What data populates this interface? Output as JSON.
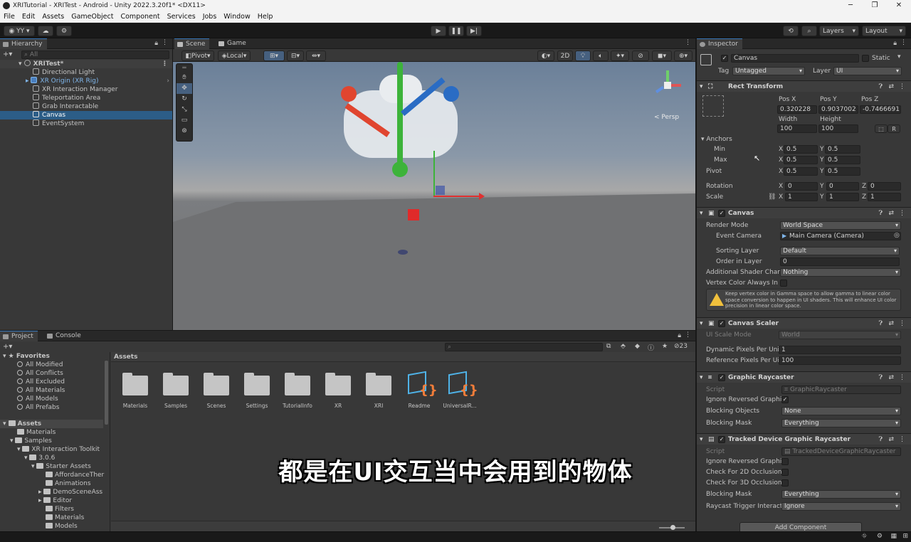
{
  "window": {
    "title": "XRITutorial - XRITest - Android - Unity 2022.3.20f1* <DX11>"
  },
  "menu": [
    "File",
    "Edit",
    "Assets",
    "GameObject",
    "Component",
    "Services",
    "Jobs",
    "Window",
    "Help"
  ],
  "toolbar": {
    "account": "YY",
    "layers": "Layers",
    "layout": "Layout"
  },
  "hierarchy": {
    "tab": "Hierarchy",
    "search_placeholder": "All",
    "scene": "XRITest*",
    "items": [
      "Directional Light",
      "XR Origin (XR Rig)",
      "XR Interaction Manager",
      "Teleportation Area",
      "Grab Interactable",
      "Canvas",
      "EventSystem"
    ],
    "selected": "Canvas"
  },
  "scene": {
    "tabs": [
      "Scene",
      "Game"
    ],
    "pivot": "Pivot",
    "local": "Local",
    "mode_2d": "2D",
    "persp": "< Persp"
  },
  "inspector": {
    "tab": "Inspector",
    "object_name": "Canvas",
    "static_label": "Static",
    "tag_label": "Tag",
    "tag_value": "Untagged",
    "layer_label": "Layer",
    "layer_value": "UI",
    "rect_transform": {
      "title": "Rect Transform",
      "pos_x_label": "Pos X",
      "pos_y_label": "Pos Y",
      "pos_z_label": "Pos Z",
      "pos_x": "0.320228",
      "pos_y": "0.9037002",
      "pos_z": "-0.7466691",
      "width_label": "Width",
      "height_label": "Height",
      "width": "100",
      "height": "100",
      "r_button": "R",
      "anchors_label": "Anchors",
      "min_label": "Min",
      "max_label": "Max",
      "min_x": "0.5",
      "min_y": "0.5",
      "max_x": "0.5",
      "max_y": "0.5",
      "pivot_label": "Pivot",
      "pivot_x": "0.5",
      "pivot_y": "0.5",
      "rotation_label": "Rotation",
      "rot_x": "0",
      "rot_y": "0",
      "rot_z": "0",
      "scale_label": "Scale",
      "scale_x": "1",
      "scale_y": "1",
      "scale_z": "1",
      "axis_x": "X",
      "axis_y": "Y",
      "axis_z": "Z"
    },
    "canvas": {
      "title": "Canvas",
      "render_mode_label": "Render Mode",
      "render_mode": "World Space",
      "event_camera_label": "Event Camera",
      "event_camera": "Main Camera (Camera)",
      "sorting_layer_label": "Sorting Layer",
      "sorting_layer": "Default",
      "order_label": "Order in Layer",
      "order": "0",
      "shader_label": "Additional Shader Char",
      "shader": "Nothing",
      "vertex_label": "Vertex Color Always In",
      "warning": "Keep vertex color in Gamma space to allow gamma to linear color space conversion to happen in UI shaders. This will enhance UI color precision in linear color space."
    },
    "canvas_scaler": {
      "title": "Canvas Scaler",
      "ui_scale_label": "UI Scale Mode",
      "ui_scale": "World",
      "dynamic_label": "Dynamic Pixels Per Uni",
      "dynamic": "1",
      "reference_label": "Reference Pixels Per Ui",
      "reference": "100"
    },
    "graphic_raycaster": {
      "title": "Graphic Raycaster",
      "script_label": "Script",
      "script": "GraphicRaycaster",
      "ignore_label": "Ignore Reversed Graphic",
      "blocking_objects_label": "Blocking Objects",
      "blocking_objects": "None",
      "blocking_mask_label": "Blocking Mask",
      "blocking_mask": "Everything"
    },
    "tracked_raycaster": {
      "title": "Tracked Device Graphic Raycaster",
      "script_label": "Script",
      "script": "TrackedDeviceGraphicRaycaster",
      "ignore_label": "Ignore Reversed Graphic",
      "check2d_label": "Check For 2D Occlusion",
      "check3d_label": "Check For 3D Occlusion",
      "blocking_mask_label": "Blocking Mask",
      "blocking_mask": "Everything",
      "raycast_trigger_label": "Raycast Trigger Interacti",
      "raycast_trigger": "Ignore"
    },
    "add_component": "Add Component"
  },
  "project": {
    "tabs": [
      "Project",
      "Console"
    ],
    "favorites_label": "Favorites",
    "favorites": [
      "All Modified",
      "All Conflicts",
      "All Excluded",
      "All Materials",
      "All Models",
      "All Prefabs"
    ],
    "tree": [
      {
        "label": "Assets",
        "level": 0
      },
      {
        "label": "Materials",
        "level": 1
      },
      {
        "label": "Samples",
        "level": 1
      },
      {
        "label": "XR Interaction Toolkit",
        "level": 2
      },
      {
        "label": "3.0.6",
        "level": 3
      },
      {
        "label": "Starter Assets",
        "level": 4
      },
      {
        "label": "AffordanceTher",
        "level": 5
      },
      {
        "label": "Animations",
        "level": 5
      },
      {
        "label": "DemoSceneAss",
        "level": 5
      },
      {
        "label": "Editor",
        "level": 5
      },
      {
        "label": "Filters",
        "level": 5
      },
      {
        "label": "Materials",
        "level": 5
      },
      {
        "label": "Models",
        "level": 5
      }
    ],
    "breadcrumb": "Assets",
    "hidden_count": "23",
    "assets": [
      {
        "name": "Materials",
        "kind": "folder"
      },
      {
        "name": "Samples",
        "kind": "folder"
      },
      {
        "name": "Scenes",
        "kind": "folder"
      },
      {
        "name": "Settings",
        "kind": "folder"
      },
      {
        "name": "TutorialInfo",
        "kind": "folder"
      },
      {
        "name": "XR",
        "kind": "folder"
      },
      {
        "name": "XRI",
        "kind": "folder"
      },
      {
        "name": "Readme",
        "kind": "script"
      },
      {
        "name": "UniversalR...",
        "kind": "script"
      }
    ]
  },
  "subtitle": "都是在UI交互当中会用到的物体"
}
